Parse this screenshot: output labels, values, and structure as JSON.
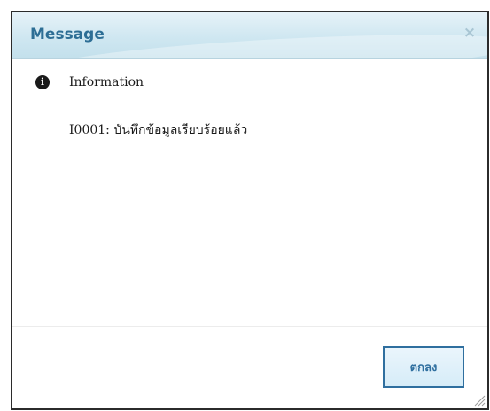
{
  "dialog": {
    "title": "Message",
    "close_glyph": "×",
    "info": {
      "icon": "info-circle-icon",
      "label": "Information"
    },
    "message": "I0001: บันทึกข้อมูลเรียบร้อยแล้ว",
    "ok_label": "ตกลง"
  },
  "colors": {
    "title_text": "#2d6e95",
    "button_border": "#2f6f9f"
  }
}
